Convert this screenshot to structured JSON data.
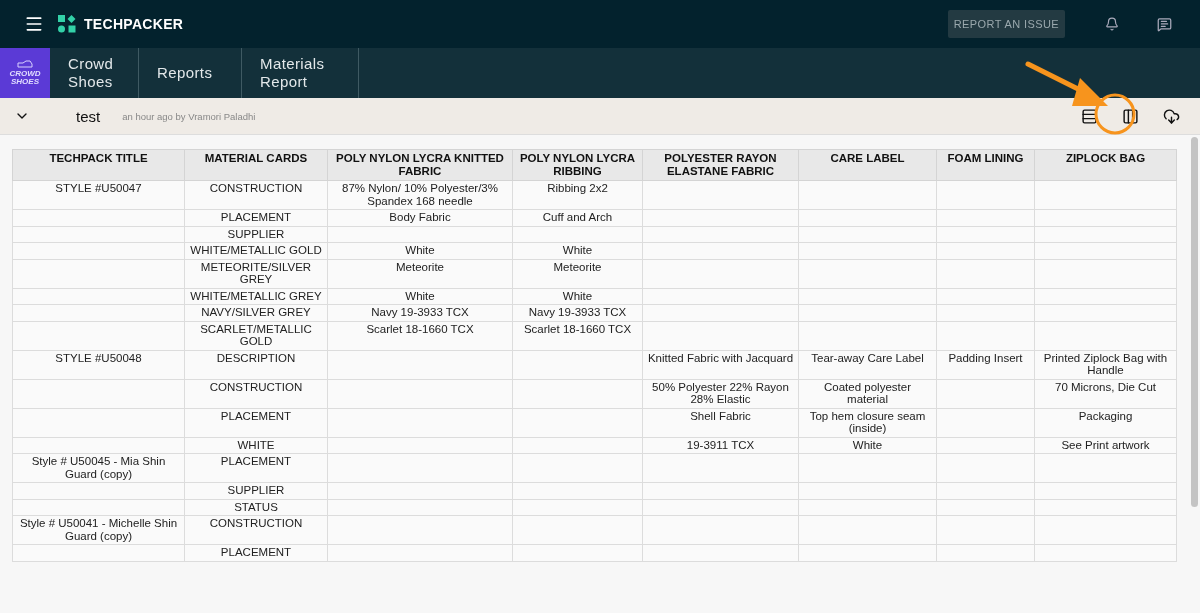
{
  "topbar": {
    "brand": "TECHPACKER",
    "report_button": "REPORT AN ISSUE"
  },
  "nav": {
    "brand_tile": "CROWD SHOES",
    "tabs": [
      {
        "label": "Crowd Shoes"
      },
      {
        "label": "Reports"
      },
      {
        "label": "Materials Report"
      }
    ]
  },
  "report": {
    "title": "test",
    "meta": "an hour ago by Vramori Paladhi"
  },
  "table": {
    "columns": [
      "TECHPACK TITLE",
      "MATERIAL CARDS",
      "POLY NYLON LYCRA KNITTED FABRIC",
      "POLY NYLON LYCRA RIBBING",
      "POLYESTER RAYON ELASTANE FABRIC",
      "CARE LABEL",
      "FOAM LINING",
      "ZIPLOCK BAG"
    ],
    "rows": [
      [
        "STYLE #U50047",
        "CONSTRUCTION",
        "87% Nylon/ 10% Polyester/3% Spandex 168 needle",
        "Ribbing 2x2",
        null,
        null,
        null,
        null
      ],
      [
        null,
        "PLACEMENT",
        "Body Fabric",
        "Cuff and Arch",
        null,
        null,
        null,
        null
      ],
      [
        null,
        "SUPPLIER",
        null,
        null,
        null,
        null,
        null,
        null
      ],
      [
        null,
        "WHITE/METALLIC GOLD",
        "White",
        "White",
        null,
        null,
        null,
        null
      ],
      [
        null,
        "METEORITE/SILVER GREY",
        "Meteorite",
        "Meteorite",
        null,
        null,
        null,
        null
      ],
      [
        null,
        "WHITE/METALLIC GREY",
        "White",
        "White",
        null,
        null,
        null,
        null
      ],
      [
        null,
        "NAVY/SILVER GREY",
        "Navy 19-3933 TCX",
        "Navy 19-3933 TCX",
        null,
        null,
        null,
        null
      ],
      [
        null,
        "SCARLET/METALLIC GOLD",
        "Scarlet 18-1660 TCX",
        "Scarlet 18-1660 TCX",
        null,
        null,
        null,
        null
      ],
      [
        "STYLE #U50048",
        "DESCRIPTION",
        null,
        null,
        "Knitted Fabric with Jacquard",
        "Tear-away Care Label",
        "Padding Insert",
        "Printed Ziplock Bag with Handle"
      ],
      [
        null,
        "CONSTRUCTION",
        null,
        null,
        "50% Polyester 22% Rayon 28% Elastic",
        "Coated polyester material",
        null,
        "70 Microns, Die Cut"
      ],
      [
        null,
        "PLACEMENT",
        null,
        null,
        "Shell Fabric",
        "Top hem closure seam (inside)",
        null,
        "Packaging"
      ],
      [
        null,
        "WHITE",
        null,
        null,
        "19-3911 TCX",
        "White",
        null,
        "See Print artwork"
      ],
      [
        "Style # U50045 - Mia Shin Guard (copy)",
        "PLACEMENT",
        null,
        null,
        null,
        null,
        null,
        null
      ],
      [
        null,
        "SUPPLIER",
        null,
        null,
        null,
        null,
        null,
        null
      ],
      [
        null,
        "STATUS",
        null,
        null,
        null,
        null,
        null,
        null
      ],
      [
        "Style # U50041 - Michelle Shin Guard (copy)",
        "CONSTRUCTION",
        null,
        null,
        null,
        null,
        null,
        null
      ],
      [
        null,
        "PLACEMENT",
        null,
        null,
        null,
        null,
        null,
        null
      ]
    ]
  }
}
